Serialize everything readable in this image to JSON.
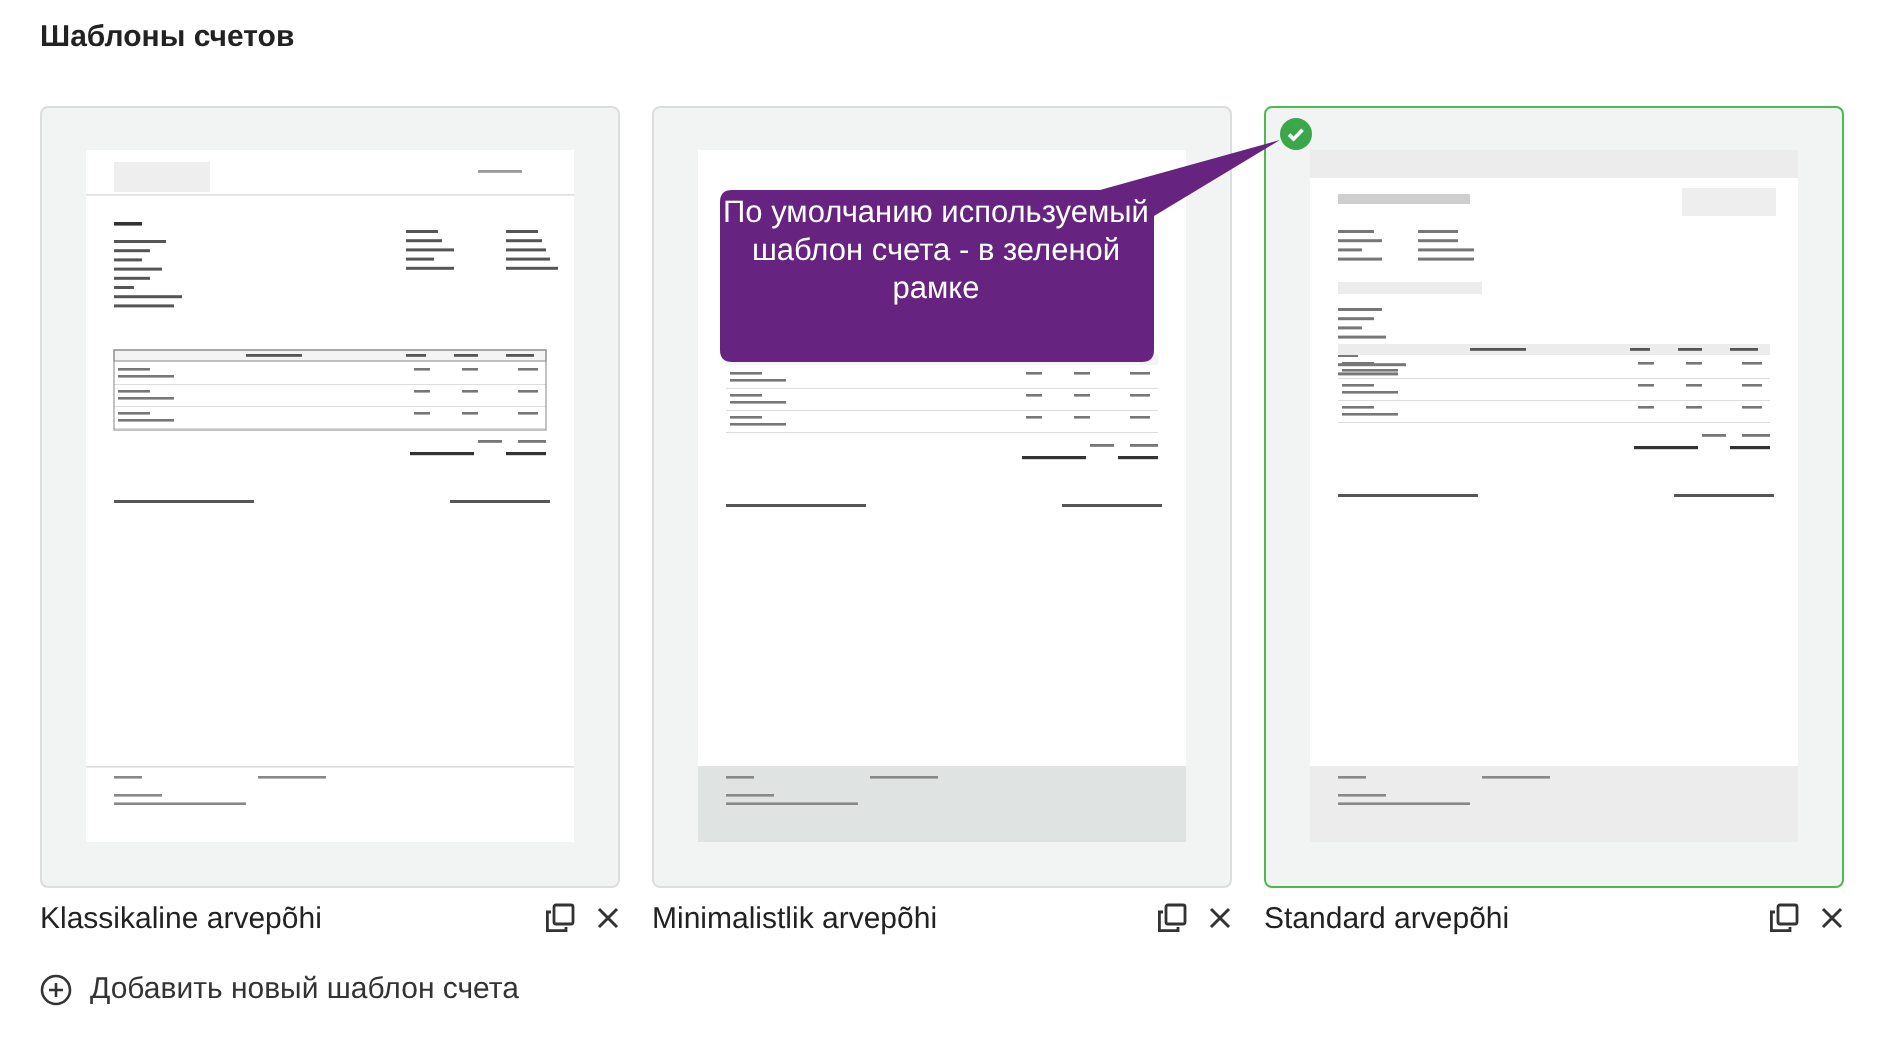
{
  "title": "Шаблоны счетов",
  "templates": [
    {
      "name": "Klassikaline arvepõhi",
      "kind": "classic",
      "selected": false
    },
    {
      "name": "Minimalistlik arvepõhi",
      "kind": "minimal",
      "selected": false
    },
    {
      "name": "Standard arvepõhi",
      "kind": "standard",
      "selected": true
    }
  ],
  "callout": {
    "text": "По умолчанию используемый шаблон счета - в зеленой рамке"
  },
  "add_button": {
    "label": "Добавить новый шаблон счета"
  }
}
